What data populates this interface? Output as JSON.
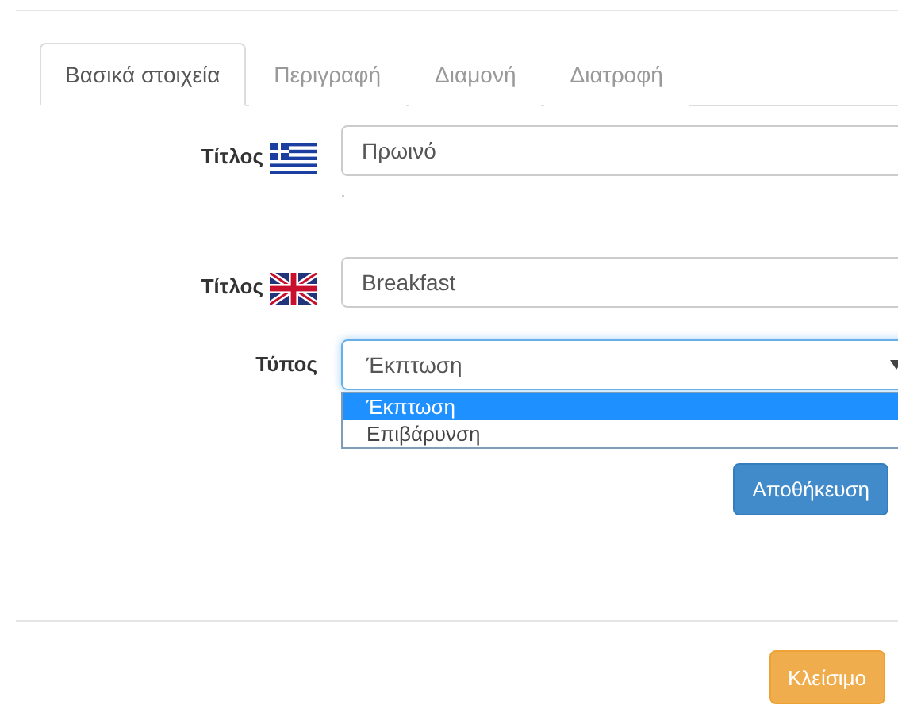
{
  "tabs": [
    {
      "label": "Βασικά στοιχεία",
      "selected": true
    },
    {
      "label": "Περιγραφή",
      "selected": false
    },
    {
      "label": "Διαμονή",
      "selected": false
    },
    {
      "label": "Διατροφή",
      "selected": false
    }
  ],
  "fields": [
    {
      "kind": "text",
      "label": "Τίτλος",
      "flag": {
        "kind": "greece"
      },
      "value": "Πρωινό",
      "note": "."
    },
    {
      "kind": "text",
      "label": "Τίτλος",
      "flag": {
        "kind": "britain"
      },
      "value": "Breakfast"
    },
    {
      "kind": "select",
      "label": "Τύπος",
      "value": "Έκπτωση",
      "expanded": true,
      "options": [
        {
          "label": "Έκπτωση",
          "selected": true
        },
        {
          "label": "Επιβάρυνση",
          "selected": false
        }
      ]
    }
  ],
  "save_button": "Αποθήκευση",
  "close_button": "Κλείσιμο"
}
